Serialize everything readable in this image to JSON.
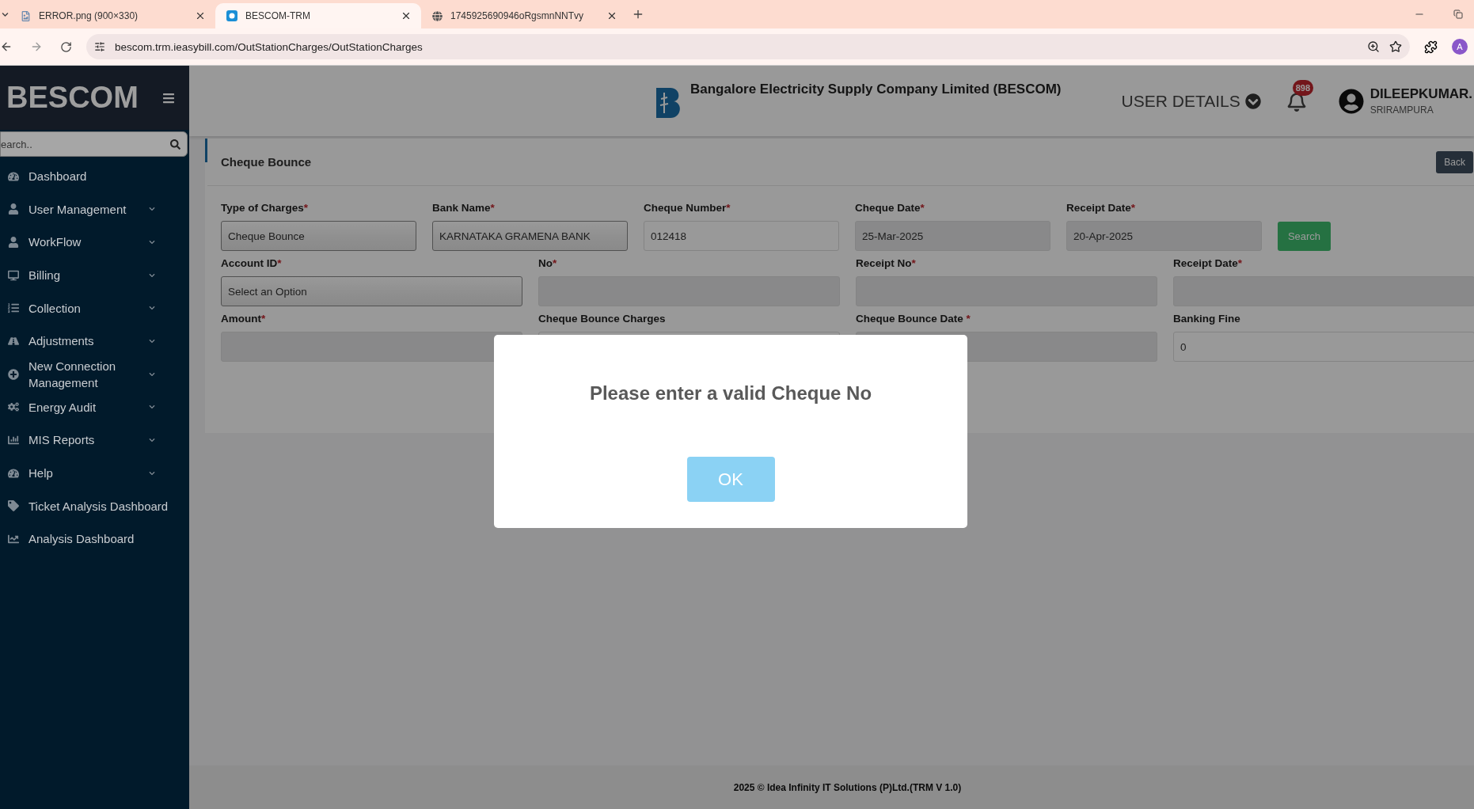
{
  "browser": {
    "tabs": [
      {
        "title": "ERROR.png (900×330)",
        "selected": false,
        "kind": "image"
      },
      {
        "title": "BESCOM-TRM",
        "selected": true,
        "kind": "site"
      },
      {
        "title": "1745925690946oRgsmnNNTvy",
        "selected": false,
        "kind": "globe"
      }
    ],
    "url": "bescom.trm.ieasybill.com/OutStationCharges/OutStationCharges",
    "profile": "A"
  },
  "sidebar": {
    "brand": "BESCOM",
    "search_placeholder": "earch..",
    "items": [
      {
        "label": "Dashboard",
        "has_submenu": false
      },
      {
        "label": "User Management",
        "has_submenu": true
      },
      {
        "label": "WorkFlow",
        "has_submenu": true
      },
      {
        "label": "Billing",
        "has_submenu": true
      },
      {
        "label": "Collection",
        "has_submenu": true
      },
      {
        "label": "Adjustments",
        "has_submenu": true
      },
      {
        "label": "New Connection Management",
        "has_submenu": true
      },
      {
        "label": "Energy Audit",
        "has_submenu": true
      },
      {
        "label": "MIS Reports",
        "has_submenu": true
      },
      {
        "label": "Help",
        "has_submenu": true
      },
      {
        "label": "Ticket Analysis Dashboard",
        "has_submenu": false
      },
      {
        "label": "Analysis Dashboard",
        "has_submenu": false
      }
    ]
  },
  "header": {
    "company": "Bangalore Electricity Supply Company Limited (BESCOM)",
    "user_details": "USER DETAILS",
    "notifications": "898",
    "user_name": "DILEEPKUMAR.",
    "user_location": "SRIRAMPURA"
  },
  "form": {
    "title": "Cheque Bounce",
    "back_button": "Back",
    "rows": [
      {
        "action": "Search",
        "fields": [
          {
            "label": "Type of Charges",
            "mark": "*",
            "kind": "select",
            "disabled": false,
            "value": "Cheque Bounce"
          },
          {
            "label": "Bank Name",
            "mark": "*",
            "kind": "select",
            "disabled": false,
            "value": "KARNATAKA GRAMENA BANK"
          },
          {
            "label": "Cheque Number",
            "mark": "*",
            "kind": "input",
            "disabled": false,
            "value": "012418"
          },
          {
            "label": "Cheque Date",
            "mark": "*",
            "kind": "input",
            "disabled": true,
            "value": "25-Mar-2025"
          },
          {
            "label": "Receipt Date",
            "mark": "*",
            "kind": "input",
            "disabled": true,
            "value": "20-Apr-2025"
          }
        ]
      },
      {
        "fields": [
          {
            "label": "Account ID",
            "mark": "*",
            "kind": "select",
            "disabled": false,
            "value": "Select an Option"
          },
          {
            "label": "No",
            "mark": "*",
            "kind": "input",
            "disabled": true
          },
          {
            "label": "Receipt No",
            "mark": "*",
            "kind": "input",
            "disabled": true
          },
          {
            "label": "Receipt Date",
            "mark": "*",
            "kind": "input",
            "disabled": true
          }
        ]
      },
      {
        "fields": [
          {
            "label": "Amount",
            "mark": "*",
            "kind": "input",
            "disabled": true
          },
          {
            "label": "Cheque Bounce Charges",
            "kind": "input"
          },
          {
            "label": "Cheque Bounce Date ",
            "mark": "*",
            "kind": "input",
            "disabled": true
          },
          {
            "label": "Banking Fine",
            "kind": "input",
            "disabled": false,
            "value": "0"
          }
        ]
      }
    ]
  },
  "modal": {
    "message": "Please enter a valid Cheque No",
    "button": "OK"
  },
  "footer": "2025 © Idea Infinity IT Solutions (P)Ltd.(TRM V 1.0)"
}
